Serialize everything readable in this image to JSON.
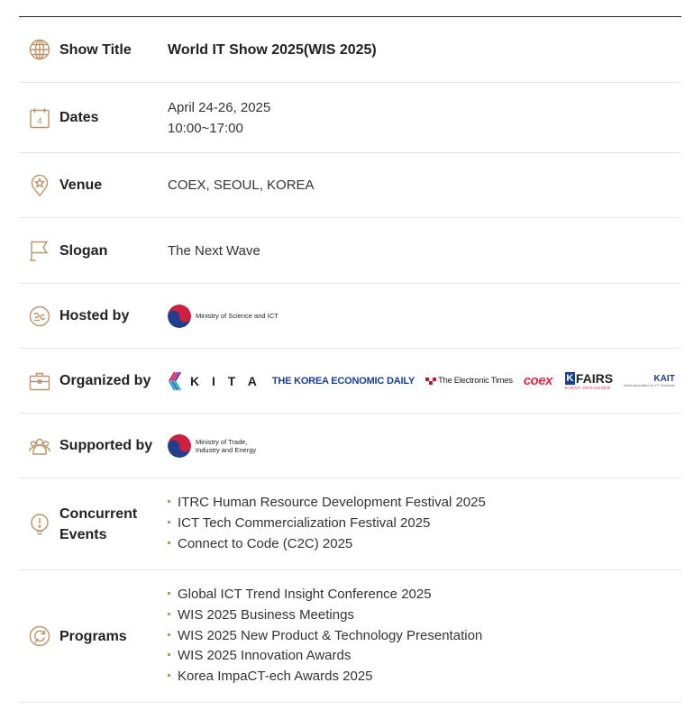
{
  "accent_color": "#b8956a",
  "rows": {
    "show_title": {
      "label": "Show Title",
      "value": "World IT Show 2025(WIS 2025)"
    },
    "dates": {
      "label": "Dates",
      "date_line": "April 24-26, 2025",
      "time_line": "10:00~17:00",
      "icon_digit": "4"
    },
    "venue": {
      "label": "Venue",
      "value": "COEX, SEOUL, KOREA"
    },
    "slogan": {
      "label": "Slogan",
      "value": "The Next Wave"
    },
    "hosted_by": {
      "label": "Hosted by",
      "logo_text": "Ministry of Science and ICT"
    },
    "organized_by": {
      "label": "Organized by",
      "logos": {
        "kita": "K I T A",
        "korea_economic_daily": "THE KOREA ECONOMIC DAILY",
        "electronic_times": "The Electronic Times",
        "coex": "coex",
        "kfairs_k": "K",
        "kfairs": "FAIRS",
        "kfairs_sub": "EVENT ORGANIZER",
        "kait": "KAIT",
        "kait_sub": "Korea Association for ICT Promotion"
      }
    },
    "supported_by": {
      "label": "Supported by",
      "logo_line1": "Ministry of Trade,",
      "logo_line2": "Industry and Energy"
    },
    "concurrent_events": {
      "label_line1": "Concurrent",
      "label_line2": "Events",
      "items": [
        "ITRC Human Resource Development Festival 2025",
        "ICT Tech Commercialization Festival 2025",
        "Connect to Code (C2C) 2025"
      ]
    },
    "programs": {
      "label": "Programs",
      "items": [
        "Global ICT Trend Insight Conference 2025",
        "WIS 2025 Business Meetings",
        "WIS 2025 New Product & Technology Presentation",
        "WIS 2025 Innovation Awards",
        "Korea ImpaCT-ech Awards 2025"
      ]
    }
  }
}
